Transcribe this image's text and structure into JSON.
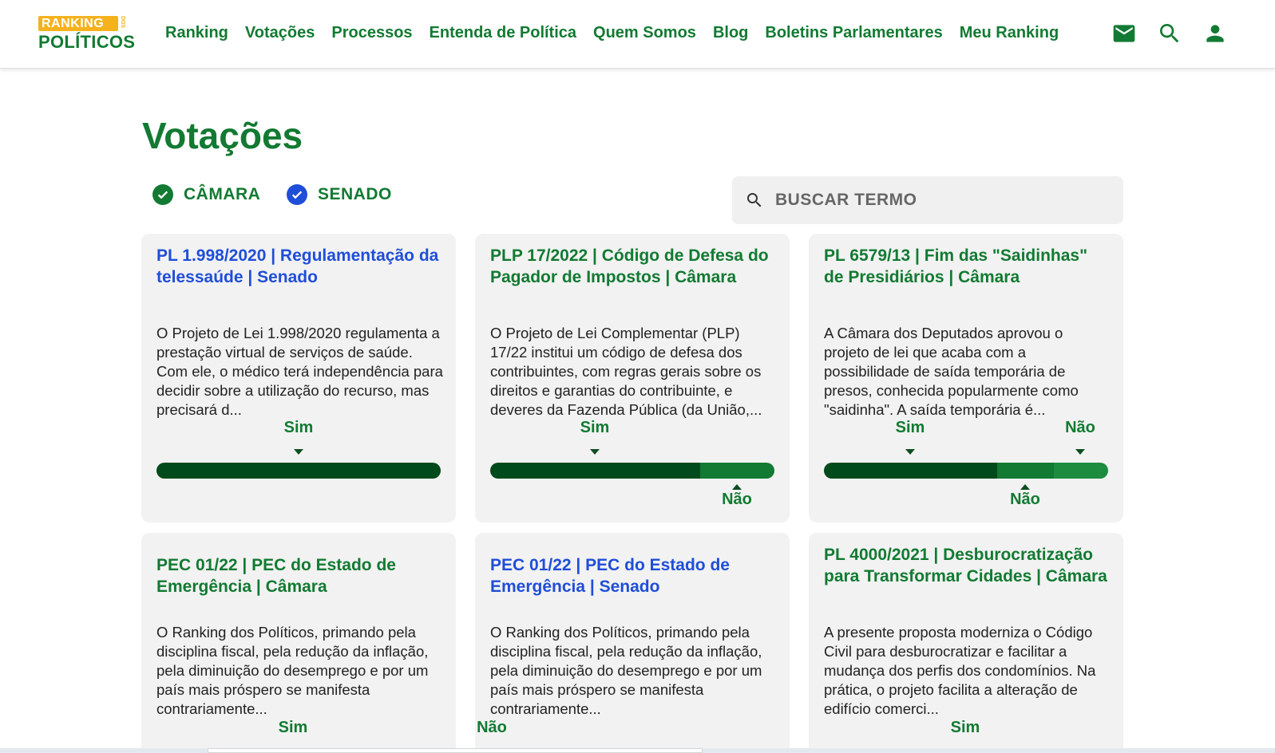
{
  "header": {
    "logo_top": "RANKING",
    "logo_dos": "DOS",
    "logo_bottom": "POLÍTICOS",
    "nav": [
      "Ranking",
      "Votações",
      "Processos",
      "Entenda de Política",
      "Quem Somos",
      "Blog",
      "Boletins Parlamentares",
      "Meu Ranking"
    ],
    "icons": [
      "mail-icon",
      "search-icon",
      "user-icon"
    ]
  },
  "page": {
    "title": "Votações"
  },
  "filters": [
    {
      "label": "CÂMARA",
      "checked": true,
      "color": "#127a32"
    },
    {
      "label": "SENADO",
      "checked": true,
      "color": "#1f4ed8"
    }
  ],
  "search": {
    "placeholder": "BUSCAR TERMO"
  },
  "colors": {
    "brand_green": "#127a32",
    "dark_green": "#004a1b",
    "senado_blue": "#1f4ed8",
    "logo_yellow": "#f5b21d"
  },
  "cards": [
    {
      "title": "PL 1.998/2020 | Regulamentação da telessaúde | Senado",
      "house": "senado",
      "description": "O Projeto de Lei 1.998/2020 regulamenta a prestação virtual de serviços de saúde. Com ele, o médico terá independência para decidir sobre a utilização do recurso, mas precisará d...",
      "sim_label": "Sim",
      "nao_label": "",
      "result": {
        "sim_share": 1.0,
        "nao_share": 0.0,
        "other_share": 0.0
      }
    },
    {
      "title": "PLP 17/2022 | Código de Defesa do Pagador de Impostos | Câmara",
      "house": "camara",
      "description": "O Projeto de Lei Complementar (PLP) 17/22 institui um código de defesa dos contribuintes, com regras gerais sobre os direitos e garantias do contribuinte, e deveres da Fazenda Pública (da União,...",
      "sim_label": "Sim",
      "nao_label": "Não",
      "result": {
        "sim_share": 0.74,
        "nao_share": 0.26,
        "other_share": 0.0
      }
    },
    {
      "title": "PL 6579/13 | Fim das \"Saidinhas\" de Presidiários | Câmara",
      "house": "camara",
      "description": "A Câmara dos Deputados aprovou o projeto de lei que acaba com a possibilidade de saída temporária de presos, conhecida popularmente como \"saidinha\". A saída temporária é...",
      "sim_label": "Sim",
      "nao_label": "Não",
      "expected_label": "Não",
      "result": {
        "sim_share": 0.61,
        "nao_share": 0.2,
        "other_share": 0.19
      }
    },
    {
      "title": "PEC 01/22 | PEC do Estado de Emergência | Câmara",
      "house": "camara",
      "description": "O Ranking dos Políticos, primando pela disciplina fiscal, pela redução da inflação, pela diminuição do desemprego e por um país mais próspero se manifesta contrariamente...",
      "sim_label": "Sim",
      "nao_label": ""
    },
    {
      "title": "PEC 01/22 | PEC do Estado de Emergência | Senado",
      "house": "senado",
      "description": "O Ranking dos Políticos, primando pela disciplina fiscal, pela redução da inflação, pela diminuição do desemprego e por um país mais próspero se manifesta contrariamente...",
      "sim_label": "",
      "nao_label": "Não"
    },
    {
      "title": "PL 4000/2021 | Desburocratização para Transformar Cidades | Câmara",
      "house": "camara",
      "description": "A presente proposta moderniza o Código Civil para desburocratizar e facilitar a mudança dos perfis dos condomínios. Na prática, o projeto facilita a alteração de edifício comerci...",
      "sim_label": "Sim",
      "nao_label": ""
    }
  ]
}
